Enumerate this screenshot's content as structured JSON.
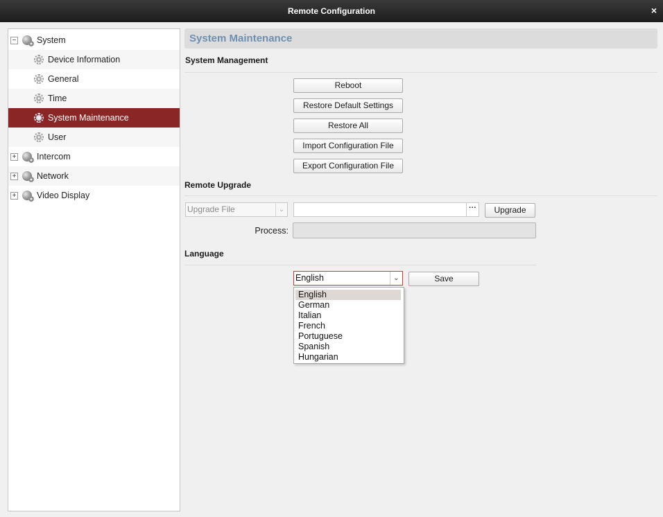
{
  "window": {
    "title": "Remote Configuration",
    "close_glyph": "×"
  },
  "sidebar": {
    "groups": [
      {
        "label": "System",
        "expander": "−",
        "icon": "globe-icon",
        "children": [
          {
            "label": "Device Information",
            "icon": "gear-icon"
          },
          {
            "label": "General",
            "icon": "gear-icon"
          },
          {
            "label": "Time",
            "icon": "gear-icon"
          },
          {
            "label": "System Maintenance",
            "icon": "gear-icon",
            "selected": true
          },
          {
            "label": "User",
            "icon": "gear-icon"
          }
        ]
      },
      {
        "label": "Intercom",
        "expander": "+",
        "icon": "globe-icon"
      },
      {
        "label": "Network",
        "expander": "+",
        "icon": "globe-icon"
      },
      {
        "label": "Video Display",
        "expander": "+",
        "icon": "globe-icon"
      }
    ]
  },
  "main": {
    "page_title": "System Maintenance",
    "system_management": {
      "title": "System Management",
      "buttons": {
        "reboot": "Reboot",
        "restore_default": "Restore Default Settings",
        "restore_all": "Restore All",
        "import_config": "Import Configuration File",
        "export_config": "Export Configuration File"
      }
    },
    "remote_upgrade": {
      "title": "Remote Upgrade",
      "file_type_value": "Upgrade File",
      "file_path_value": "",
      "browse_glyph": "···",
      "upgrade_button": "Upgrade",
      "process_label": "Process:",
      "progress": 0
    },
    "language": {
      "title": "Language",
      "selected": "English",
      "save_button": "Save",
      "options": [
        "English",
        "German",
        "Italian",
        "French",
        "Portuguese",
        "Spanish",
        "Hungarian"
      ],
      "highlighted_option": "English"
    }
  },
  "colors": {
    "selection": "#8a2626",
    "page_title": "#6f8fb2",
    "focus_border": "#d03434"
  }
}
